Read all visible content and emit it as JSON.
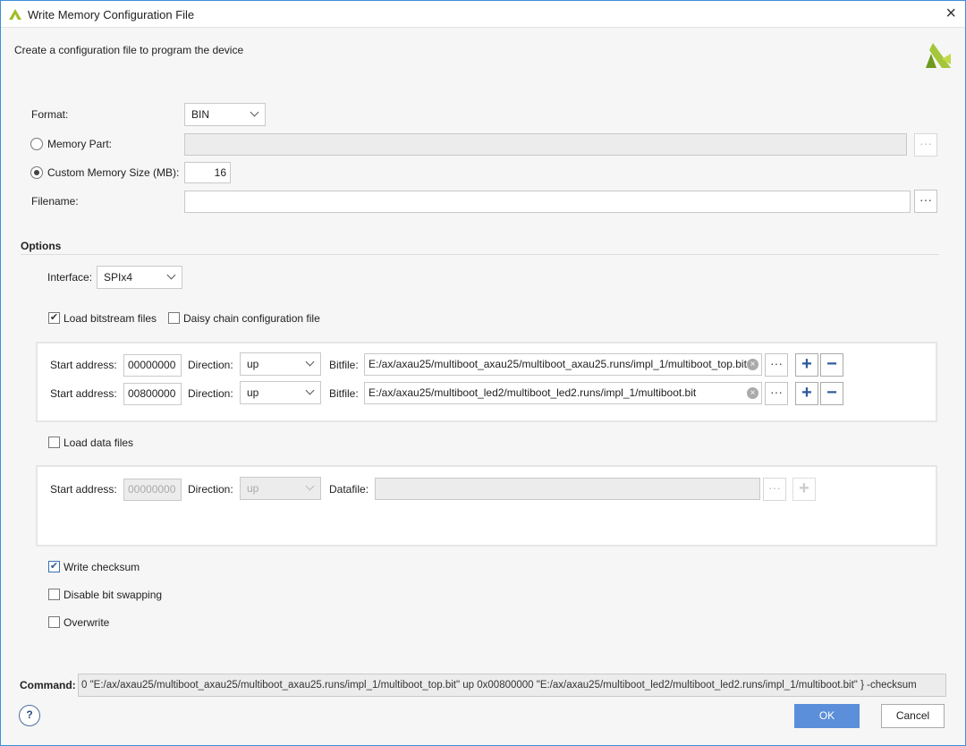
{
  "title": "Write Memory Configuration File",
  "subtitle": "Create a configuration file to program the device",
  "format": {
    "label": "Format:",
    "value": "BIN"
  },
  "memory_part": {
    "label": "Memory Part:",
    "value": "",
    "selected": false
  },
  "custom_size": {
    "label": "Custom Memory Size (MB):",
    "value": "16",
    "selected": true
  },
  "filename": {
    "label": "Filename:",
    "value": ""
  },
  "options": {
    "title": "Options",
    "interface_label": "Interface:",
    "interface_value": "SPIx4",
    "load_bitstream": {
      "label": "Load bitstream files",
      "checked": true
    },
    "daisy_chain": {
      "label": "Daisy chain configuration file",
      "checked": false
    },
    "load_data": {
      "label": "Load data files",
      "checked": false
    },
    "write_checksum": {
      "label": "Write checksum",
      "checked": true
    },
    "disable_swap": {
      "label": "Disable bit swapping",
      "checked": false
    },
    "overwrite": {
      "label": "Overwrite",
      "checked": false
    }
  },
  "bitfiles": [
    {
      "start_label": "Start address:",
      "start": "00000000",
      "dir_label": "Direction:",
      "dir": "up",
      "file_label": "Bitfile:",
      "file": "E:/ax/axau25/multiboot_axau25/multiboot_axau25.runs/impl_1/multiboot_top.bit"
    },
    {
      "start_label": "Start address:",
      "start": "00800000",
      "dir_label": "Direction:",
      "dir": "up",
      "file_label": "Bitfile:",
      "file": "E:/ax/axau25/multiboot_led2/multiboot_led2.runs/impl_1/multiboot.bit"
    }
  ],
  "datafile": {
    "start_label": "Start address:",
    "start": "00000000",
    "dir_label": "Direction:",
    "dir": "up",
    "file_label": "Datafile:",
    "file": ""
  },
  "command": {
    "label": "Command:",
    "value": "0 \"E:/ax/axau25/multiboot_axau25/multiboot_axau25.runs/impl_1/multiboot_top.bit\" up 0x00800000 \"E:/ax/axau25/multiboot_led2/multiboot_led2.runs/impl_1/multiboot.bit\" } -checksum"
  },
  "buttons": {
    "ok": "OK",
    "cancel": "Cancel",
    "help": "?",
    "close": "×",
    "browse": "···",
    "plus": "+",
    "minus": "−",
    "check": "✔"
  },
  "colors": {
    "accent": "#5b8fd9",
    "logo": "#8ab52a"
  }
}
